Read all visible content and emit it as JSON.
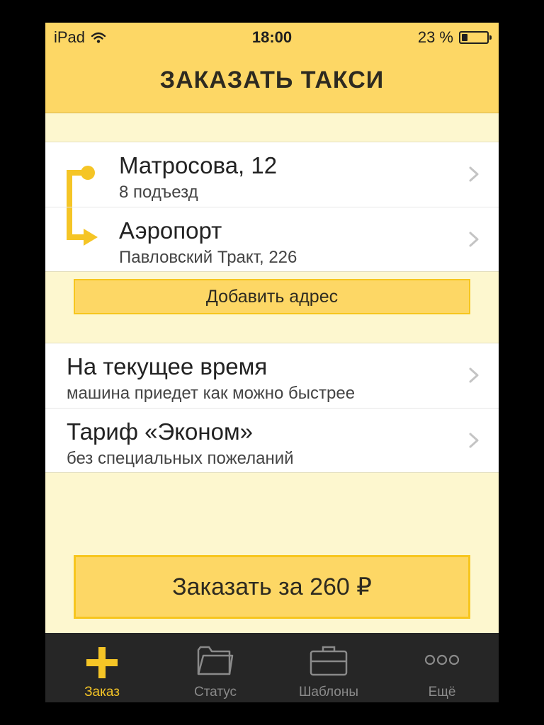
{
  "colors": {
    "accent": "#fdd765",
    "accent_border": "#f7c61e",
    "background": "#fdf7cf",
    "tabbar": "#262626",
    "tab_active": "#f5c526"
  },
  "status_bar": {
    "device": "iPad",
    "time": "18:00",
    "battery": "23 %",
    "battery_level": 0.23
  },
  "navbar": {
    "title": "ЗАКАЗАТЬ ТАКСИ"
  },
  "route": {
    "from": {
      "title": "Матросова, 12",
      "subtitle": "8 подъезд"
    },
    "to": {
      "title": "Аэропорт",
      "subtitle": "Павловский Тракт, 226"
    }
  },
  "add_address_label": "Добавить адрес",
  "options": {
    "time": {
      "title": "На текущее время",
      "subtitle": "машина приедет как можно быстрее"
    },
    "tariff": {
      "title": "Тариф «Эконом»",
      "subtitle": "без специальных пожеланий"
    }
  },
  "order_button_label": "Заказать за 260 ₽",
  "tabs": [
    {
      "label": "Заказ",
      "icon": "plus-icon",
      "active": true
    },
    {
      "label": "Статус",
      "icon": "folder-icon",
      "active": false
    },
    {
      "label": "Шаблоны",
      "icon": "briefcase-icon",
      "active": false
    },
    {
      "label": "Ещё",
      "icon": "more-icon",
      "active": false
    }
  ]
}
